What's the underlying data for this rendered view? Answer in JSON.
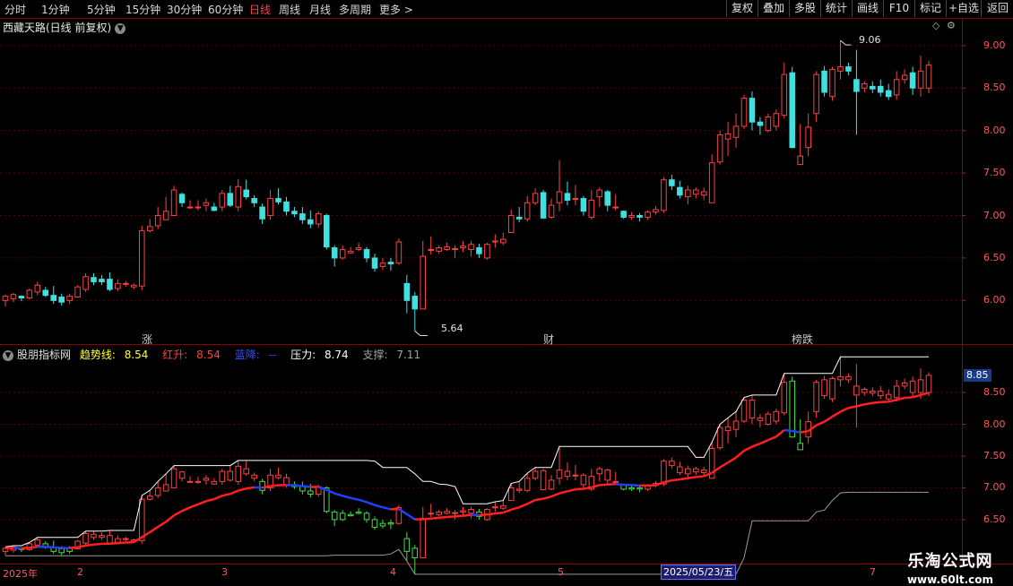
{
  "toolbar": {
    "periods": [
      "分时",
      "1分钟",
      "5分钟",
      "15分钟",
      "30分钟",
      "60分钟",
      "日线",
      "周线",
      "月线",
      "多周期",
      "更多"
    ],
    "active_period": "日线",
    "right_buttons": [
      "复权",
      "叠加",
      "多股",
      "统计",
      "画线",
      "F10",
      "标记",
      "+自选",
      "返回"
    ]
  },
  "main_chart": {
    "title": "西藏天路(日线 前复权)",
    "high_marker": "9.06",
    "low_marker": "5.64",
    "y_ticks": [
      "9.00",
      "8.50",
      "8.00",
      "7.50",
      "7.00",
      "6.50",
      "6.00"
    ],
    "events": [
      {
        "label": "涨",
        "color": "#ff4040"
      },
      {
        "label": "财",
        "color": "#3aa0ff"
      },
      {
        "label": "榜跌",
        "color": "#ffd040"
      }
    ]
  },
  "indicator": {
    "name": "股朋指标网",
    "trend_label": "趋势线:",
    "trend_value": "8.54",
    "hongsheng_label": "红升:",
    "hongsheng_value": "8.54",
    "lanjiang_label": "蓝降:",
    "lanjiang_value": "--",
    "yali_label": "压力:",
    "yali_value": "8.74",
    "zhicheng_label": "支撑:",
    "zhicheng_value": "7.11",
    "price_box": "8.85",
    "y_ticks": [
      "8.50",
      "8.00",
      "7.50",
      "7.00",
      "6.50"
    ]
  },
  "x_axis": {
    "labels": [
      "2025年",
      "2",
      "3",
      "4",
      "5",
      "7"
    ],
    "highlight_date": "2025/05/23/五"
  },
  "watermark": {
    "line1": "乐淘公式网",
    "line2": "www.60lt.com"
  },
  "colors": {
    "up": "#ff4040",
    "down": "#40e0e0",
    "trend_red": "#ff2020",
    "trend_blue": "#2040ff",
    "resistance": "#ffffff",
    "support": "#9a9a9a"
  },
  "chart_data": {
    "type": "candlestick",
    "ohlc": [
      [
        6.0,
        6.07,
        5.93,
        6.05
      ],
      [
        6.02,
        6.09,
        5.98,
        6.07
      ],
      [
        6.05,
        6.06,
        5.99,
        6.03
      ],
      [
        6.03,
        6.14,
        6.01,
        6.12
      ],
      [
        6.1,
        6.22,
        6.06,
        6.18
      ],
      [
        6.12,
        6.16,
        6.04,
        6.06
      ],
      [
        6.06,
        6.17,
        5.96,
        6.0
      ],
      [
        6.04,
        6.08,
        5.94,
        5.98
      ],
      [
        6.0,
        6.08,
        5.96,
        6.05
      ],
      [
        6.04,
        6.18,
        6.03,
        6.16
      ],
      [
        6.13,
        6.32,
        6.1,
        6.28
      ],
      [
        6.27,
        6.32,
        6.18,
        6.22
      ],
      [
        6.25,
        6.3,
        6.18,
        6.22
      ],
      [
        6.25,
        6.33,
        6.11,
        6.13
      ],
      [
        6.14,
        6.25,
        6.11,
        6.2
      ],
      [
        6.19,
        6.23,
        6.16,
        6.2
      ],
      [
        6.16,
        6.2,
        6.13,
        6.18
      ],
      [
        6.17,
        6.88,
        6.12,
        6.82
      ],
      [
        6.82,
        6.96,
        6.8,
        6.87
      ],
      [
        6.88,
        7.1,
        6.84,
        7.0
      ],
      [
        6.95,
        7.22,
        6.95,
        7.05
      ],
      [
        7.0,
        7.35,
        7.0,
        7.3
      ],
      [
        7.25,
        7.27,
        7.1,
        7.15
      ],
      [
        7.1,
        7.18,
        7.08,
        7.1
      ],
      [
        7.1,
        7.18,
        7.06,
        7.1
      ],
      [
        7.12,
        7.2,
        7.05,
        7.15
      ],
      [
        7.1,
        7.15,
        7.05,
        7.06
      ],
      [
        7.1,
        7.3,
        7.05,
        7.26
      ],
      [
        7.26,
        7.35,
        7.1,
        7.12
      ],
      [
        7.1,
        7.43,
        7.05,
        7.34
      ],
      [
        7.3,
        7.42,
        7.19,
        7.22
      ],
      [
        7.2,
        7.24,
        7.1,
        7.15
      ],
      [
        7.1,
        7.14,
        6.9,
        6.96
      ],
      [
        7.0,
        7.3,
        6.95,
        7.2
      ],
      [
        7.2,
        7.32,
        7.13,
        7.16
      ],
      [
        7.16,
        7.22,
        7.0,
        7.05
      ],
      [
        7.05,
        7.1,
        6.98,
        7.02
      ],
      [
        7.02,
        7.1,
        6.9,
        6.95
      ],
      [
        6.95,
        7.06,
        6.85,
        6.9
      ],
      [
        6.9,
        7.05,
        6.86,
        7.02
      ],
      [
        7.0,
        7.02,
        6.6,
        6.63
      ],
      [
        6.62,
        6.65,
        6.4,
        6.5
      ],
      [
        6.5,
        6.65,
        6.48,
        6.6
      ],
      [
        6.56,
        6.63,
        6.55,
        6.58
      ],
      [
        6.6,
        6.68,
        6.58,
        6.62
      ],
      [
        6.6,
        6.63,
        6.45,
        6.5
      ],
      [
        6.5,
        6.55,
        6.34,
        6.38
      ],
      [
        6.4,
        6.5,
        6.36,
        6.44
      ],
      [
        6.45,
        6.5,
        6.35,
        6.43
      ],
      [
        6.44,
        6.73,
        6.42,
        6.69
      ],
      [
        6.2,
        6.3,
        5.85,
        6.0
      ],
      [
        6.05,
        6.1,
        5.64,
        5.9
      ],
      [
        5.9,
        6.7,
        5.9,
        6.52
      ],
      [
        6.6,
        6.75,
        6.54,
        6.6
      ],
      [
        6.58,
        6.65,
        6.55,
        6.62
      ],
      [
        6.6,
        6.68,
        6.58,
        6.63
      ],
      [
        6.6,
        6.65,
        6.5,
        6.61
      ],
      [
        6.62,
        6.7,
        6.57,
        6.64
      ],
      [
        6.6,
        6.7,
        6.52,
        6.66
      ],
      [
        6.62,
        6.67,
        6.5,
        6.55
      ],
      [
        6.5,
        6.68,
        6.48,
        6.66
      ],
      [
        6.7,
        6.78,
        6.62,
        6.7
      ],
      [
        6.68,
        6.8,
        6.65,
        6.72
      ],
      [
        6.8,
        7.07,
        6.8,
        7.0
      ],
      [
        6.98,
        7.1,
        6.92,
        6.96
      ],
      [
        6.96,
        7.23,
        6.93,
        7.15
      ],
      [
        7.15,
        7.32,
        7.12,
        7.26
      ],
      [
        7.27,
        7.3,
        6.96,
        6.97
      ],
      [
        6.98,
        7.2,
        6.96,
        7.12
      ],
      [
        7.15,
        7.65,
        7.05,
        7.28
      ],
      [
        7.26,
        7.4,
        7.12,
        7.18
      ],
      [
        7.2,
        7.36,
        7.12,
        7.2
      ],
      [
        7.2,
        7.23,
        7.0,
        7.05
      ],
      [
        6.98,
        7.3,
        6.95,
        7.18
      ],
      [
        7.22,
        7.33,
        7.1,
        7.3
      ],
      [
        7.28,
        7.3,
        7.05,
        7.12
      ],
      [
        7.1,
        7.25,
        7.06,
        7.1
      ],
      [
        7.05,
        7.06,
        6.96,
        6.98
      ],
      [
        6.98,
        7.04,
        6.95,
        7.0
      ],
      [
        7.0,
        7.03,
        6.93,
        6.98
      ],
      [
        6.98,
        7.06,
        6.95,
        7.04
      ],
      [
        7.04,
        7.11,
        7.01,
        7.07
      ],
      [
        7.06,
        7.45,
        7.03,
        7.42
      ],
      [
        7.42,
        7.48,
        7.3,
        7.35
      ],
      [
        7.33,
        7.41,
        7.2,
        7.24
      ],
      [
        7.22,
        7.35,
        7.13,
        7.3
      ],
      [
        7.25,
        7.33,
        7.2,
        7.3
      ],
      [
        7.24,
        7.33,
        7.18,
        7.28
      ],
      [
        7.15,
        7.72,
        7.15,
        7.62
      ],
      [
        7.63,
        8.0,
        7.6,
        7.95
      ],
      [
        7.9,
        8.1,
        7.7,
        7.96
      ],
      [
        7.92,
        8.2,
        7.8,
        8.05
      ],
      [
        8.05,
        8.42,
        8.02,
        8.38
      ],
      [
        8.38,
        8.46,
        8.0,
        8.1
      ],
      [
        8.1,
        8.16,
        7.95,
        8.06
      ],
      [
        8.0,
        8.2,
        7.98,
        8.16
      ],
      [
        8.05,
        8.25,
        8.0,
        8.2
      ],
      [
        8.18,
        8.8,
        8.14,
        8.66
      ],
      [
        8.68,
        8.75,
        7.79,
        7.8
      ],
      [
        7.6,
        8.08,
        7.6,
        7.7
      ],
      [
        7.8,
        8.2,
        7.7,
        8.04
      ],
      [
        8.2,
        8.7,
        8.1,
        8.66
      ],
      [
        8.7,
        8.76,
        8.4,
        8.45
      ],
      [
        8.4,
        8.75,
        8.35,
        8.72
      ],
      [
        8.7,
        9.06,
        8.6,
        8.75
      ],
      [
        8.75,
        8.8,
        8.65,
        8.7
      ],
      [
        8.6,
        8.95,
        7.95,
        8.46
      ],
      [
        8.5,
        8.58,
        8.45,
        8.55
      ],
      [
        8.52,
        8.58,
        8.44,
        8.49
      ],
      [
        8.52,
        8.6,
        8.4,
        8.45
      ],
      [
        8.47,
        8.55,
        8.36,
        8.4
      ],
      [
        8.42,
        8.7,
        8.36,
        8.6
      ],
      [
        8.6,
        8.72,
        8.55,
        8.65
      ],
      [
        8.68,
        8.75,
        8.42,
        8.5
      ],
      [
        8.5,
        8.88,
        8.4,
        8.7
      ],
      [
        8.5,
        8.82,
        8.44,
        8.77
      ]
    ],
    "xlabel": "",
    "ylabel": "",
    "ylim": [
      5.55,
      9.22
    ],
    "indicator_series": [
      {
        "name": "趋势线",
        "color": "#ff2020"
      },
      {
        "name": "压力",
        "color": "#ffffff"
      },
      {
        "name": "支撑",
        "color": "#9a9a9a"
      }
    ],
    "indicator_ylim": [
      5.85,
      8.98
    ]
  }
}
